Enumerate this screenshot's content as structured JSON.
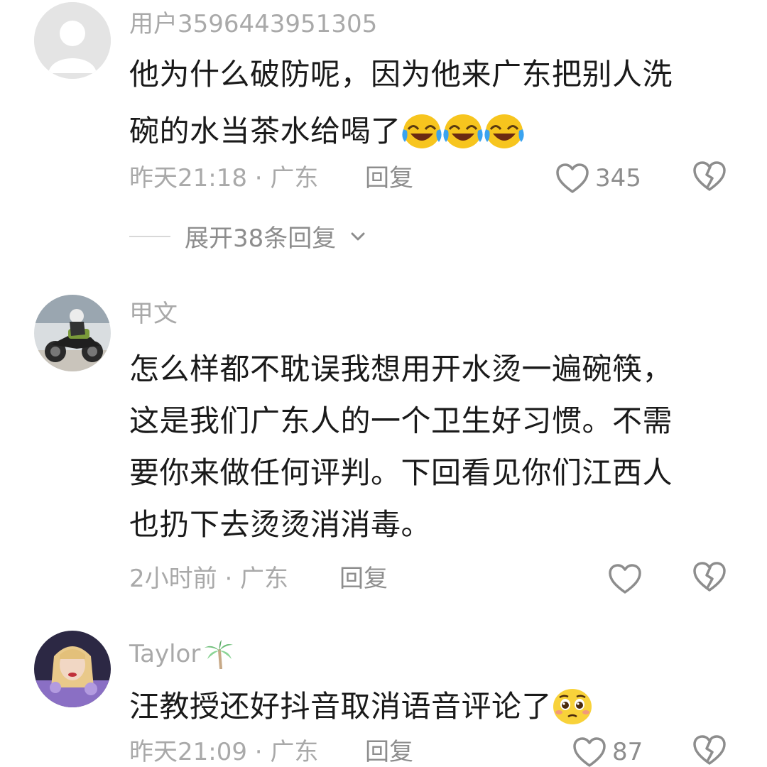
{
  "comments": [
    {
      "username": "用户3596443951305",
      "lines": [
        "他为什么破防呢，因为他来广东把别人洗",
        "碗的水当茶水给喝了"
      ],
      "emoji": [
        "laughing-crying-emoji",
        "laughing-crying-emoji",
        "laughing-crying-emoji"
      ],
      "meta": "昨天21:18 · 广东",
      "reply_label": "回复",
      "like_count": "345",
      "expand_label": "展开38条回复"
    },
    {
      "username": "甲文",
      "lines": [
        "怎么样都不耽误我想用开水烫一遍碗筷，",
        "这是我们广东人的一个卫生好习惯。不需",
        "要你来做任何评判。下回看见你们江西人",
        "也扔下去烫烫消消毒。"
      ],
      "meta": "2小时前 · 广东",
      "reply_label": "回复",
      "like_count": ""
    },
    {
      "username": "Taylor",
      "username_icon": "palm-tree-icon",
      "lines": [
        "汪教授还好抖音取消语音评论了"
      ],
      "emoji": [
        "pleading-face-emoji"
      ],
      "meta": "昨天21:09 · 广东",
      "reply_label": "回复",
      "like_count": "87"
    }
  ],
  "colors": {
    "text": "#1a1a1a",
    "meta": "#a9a9a9",
    "action": "#8d8d8d"
  }
}
